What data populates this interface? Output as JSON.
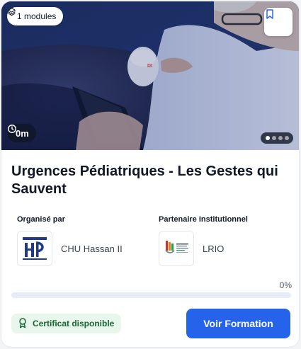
{
  "hero": {
    "modules_label": "1 modules",
    "duration_label": "0m",
    "image_alt": "Doctor performing ultrasound examination on a patient",
    "carousel": {
      "total": 4,
      "active_index": 0
    }
  },
  "course": {
    "title": "Urgences Pédiatriques - Les Gestes qui Sauvent"
  },
  "organizer": {
    "section_label": "Organisé par",
    "name": "CHU Hassan II"
  },
  "partner": {
    "section_label": "Partenaire Institutionnel",
    "name": "LRIO"
  },
  "progress": {
    "label": "0%",
    "value": 0
  },
  "certificate": {
    "label": "Certificat disponible"
  },
  "cta": {
    "label": "Voir Formation"
  },
  "colors": {
    "primary": "#2563eb",
    "success_text": "#166534",
    "success_bg": "#e8f6ec",
    "progress_track": "#e7ebf8"
  },
  "icons": {
    "modules": "layers-icon",
    "bookmark": "bookmark-icon",
    "duration": "clock-icon",
    "certificate": "award-icon"
  }
}
